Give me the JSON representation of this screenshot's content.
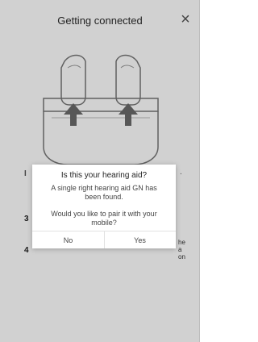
{
  "header": {
    "title": "Getting connected",
    "close_icon": "close-icon"
  },
  "background": {
    "illustration_icon": "hearing-aids-in-charger",
    "step_partial_1": "I",
    "step_partial_1_tail": ".",
    "steps": [
      {
        "number": "3"
      },
      {
        "number": "4"
      }
    ],
    "right_fragment_lines": [
      "he",
      "a",
      "on"
    ]
  },
  "dialog": {
    "title": "Is this your hearing aid?",
    "message": "A single right hearing aid GN has been found.",
    "question": "Would you like to pair it with your mobile?",
    "no_label": "No",
    "yes_label": "Yes"
  }
}
